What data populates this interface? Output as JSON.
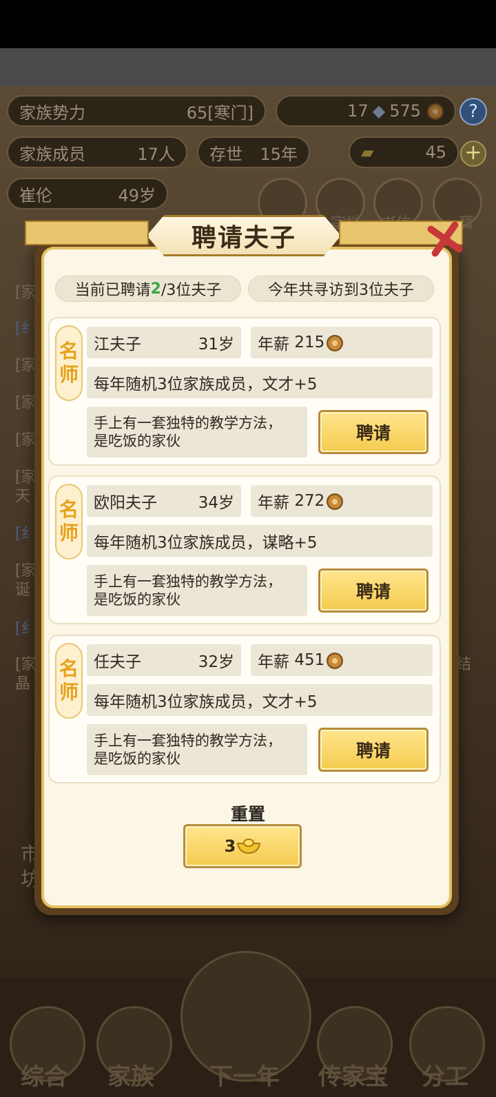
{
  "background": {
    "stats": {
      "family_power_label": "家族势力",
      "family_power_value": "65[寒门]",
      "currency_a": "17",
      "currency_b": "575",
      "members_label": "家族成员",
      "members_value": "17人",
      "alive_label": "存世",
      "alive_value": "15年",
      "gold_value": "45",
      "person_name": "崔伦",
      "person_age": "49岁"
    },
    "side_lines": [
      "[家",
      "[纟",
      "[家",
      "[家",
      "[家",
      "[家",
      "天",
      "[纟",
      "[家",
      "诞",
      "[纟",
      "[家",
      "晶",
      "结",
      "市",
      "坊"
    ],
    "icon_labels": [
      "宗档",
      "书信",
      "寶"
    ],
    "nav": [
      "综合",
      "家族",
      "下一年",
      "传家宝",
      "分工"
    ]
  },
  "dialog": {
    "title": "聘请夫子",
    "hired_prefix": "当前已聘请",
    "hired_count": "2",
    "hired_suffix": "/3位夫子",
    "visited": "今年共寻访到3位夫子",
    "badge_line1": "名",
    "badge_line2": "师",
    "salary_label": "年薪",
    "hire_label": "聘请",
    "teachers": [
      {
        "name": "江夫子",
        "age": "31岁",
        "salary": "215",
        "effect": "每年随机3位家族成员，文才+5",
        "desc_line1": "手上有一套独特的教学方法，",
        "desc_line2": "是吃饭的家伙"
      },
      {
        "name": "欧阳夫子",
        "age": "34岁",
        "salary": "272",
        "effect": "每年随机3位家族成员，谋略+5",
        "desc_line1": "手上有一套独特的教学方法，",
        "desc_line2": "是吃饭的家伙"
      },
      {
        "name": "任夫子",
        "age": "32岁",
        "salary": "451",
        "effect": "每年随机3位家族成员，文才+5",
        "desc_line1": "手上有一套独特的教学方法，",
        "desc_line2": "是吃饭的家伙"
      }
    ],
    "reset_label": "重置",
    "reset_cost": "3"
  },
  "colors": {
    "accent_gold": "#f4cb4f",
    "highlight_green": "#37a844",
    "close_red": "#c8373a",
    "badge_orange": "#e7a21b"
  }
}
